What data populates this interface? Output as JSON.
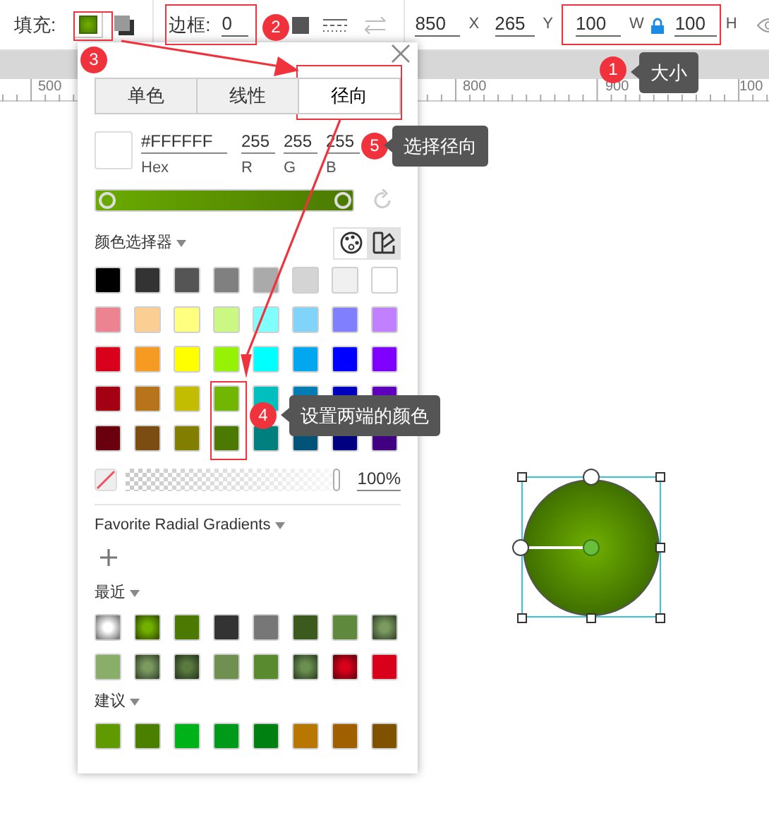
{
  "toolbar": {
    "fill_label": "填充:",
    "border_label": "边框:",
    "border_value": "0",
    "x_value": "850",
    "x_label": "X",
    "y_value": "265",
    "y_label": "Y",
    "w_value": "100",
    "w_label": "W",
    "h_value": "100",
    "h_label": "H",
    "ratio_locked": true
  },
  "ruler": {
    "labels": [
      "500",
      "800",
      "900",
      "100"
    ]
  },
  "color_panel": {
    "tabs": [
      {
        "label": "单色",
        "selected": false
      },
      {
        "label": "线性",
        "selected": false
      },
      {
        "label": "径向",
        "selected": true
      }
    ],
    "hex": "#FFFFFF",
    "hex_label": "Hex",
    "channels": [
      {
        "value": "255",
        "label": "R"
      },
      {
        "value": "255",
        "label": "G"
      },
      {
        "value": "255",
        "label": "B"
      }
    ],
    "gradient_stops": [
      {
        "color": "#6aab00"
      },
      {
        "color": "#4b7902"
      }
    ],
    "picker_label": "颜色选择器",
    "picker_modes": [
      {
        "selected": false
      },
      {
        "selected": true
      }
    ],
    "palette": [
      {
        "color": "#000000"
      },
      {
        "color": "#333333"
      },
      {
        "color": "#555555"
      },
      {
        "color": "#808080"
      },
      {
        "color": "#aaaaaa"
      },
      {
        "color": "#d4d4d4"
      },
      {
        "color": "#f0f0f0"
      },
      {
        "color": "#ffffff"
      },
      {
        "color": "#eb8391"
      },
      {
        "color": "#fbcf93"
      },
      {
        "color": "#ffff80"
      },
      {
        "color": "#cbf783"
      },
      {
        "color": "#80ffff"
      },
      {
        "color": "#80d4fa"
      },
      {
        "color": "#8080ff"
      },
      {
        "color": "#c080ff"
      },
      {
        "color": "#d9001b"
      },
      {
        "color": "#f59a23"
      },
      {
        "color": "#ffff00"
      },
      {
        "color": "#95f204"
      },
      {
        "color": "#00ffff"
      },
      {
        "color": "#02a7f0"
      },
      {
        "color": "#0000ff"
      },
      {
        "color": "#8000ff"
      },
      {
        "color": "#a30014"
      },
      {
        "color": "#b8741a"
      },
      {
        "color": "#c2bd00"
      },
      {
        "color": "#70b603"
      },
      {
        "color": "#00bfbf"
      },
      {
        "color": "#027db4"
      },
      {
        "color": "#0000bf"
      },
      {
        "color": "#6000bf"
      },
      {
        "color": "#6a000d"
      },
      {
        "color": "#7b4d12"
      },
      {
        "color": "#817e00"
      },
      {
        "color": "#4b7902"
      },
      {
        "color": "#007f7f"
      },
      {
        "color": "#015478"
      },
      {
        "color": "#000080"
      },
      {
        "color": "#400080"
      }
    ],
    "opacity_slider": {
      "level": 1
    },
    "opacity": "100%",
    "favorites_label": "Favorite Radial Gradients",
    "recent_label": "最近",
    "recent": [
      {
        "kind": "radial",
        "color": "#ffffff"
      },
      {
        "kind": "radial",
        "color": "#72b000"
      },
      {
        "kind": "solid",
        "color": "#4b7902"
      },
      {
        "kind": "solid",
        "color": "#333333"
      },
      {
        "kind": "solid",
        "color": "#777777"
      },
      {
        "kind": "solid",
        "color": "#3d5a1e"
      },
      {
        "kind": "solid",
        "color": "#5f8a3e"
      },
      {
        "kind": "radial",
        "color": "#7a9a60"
      },
      {
        "kind": "solid",
        "color": "#8aae6a"
      },
      {
        "kind": "radial",
        "color": "#7a9a60"
      },
      {
        "kind": "radial",
        "color": "#5a7a40"
      },
      {
        "kind": "solid",
        "color": "#6f9050"
      },
      {
        "kind": "solid",
        "color": "#5a8a30"
      },
      {
        "kind": "radial",
        "color": "#6a9050"
      },
      {
        "kind": "radial",
        "color": "#d9001b"
      },
      {
        "kind": "solid",
        "color": "#d9001b"
      }
    ],
    "suggested_label": "建议",
    "suggested": [
      {
        "color": "#5f9a00"
      },
      {
        "color": "#4b7f00"
      },
      {
        "color": "#00b21a"
      },
      {
        "color": "#009a1a"
      },
      {
        "color": "#008010"
      },
      {
        "color": "#b87800"
      },
      {
        "color": "#a06000"
      },
      {
        "color": "#7f5200"
      }
    ]
  },
  "annotations": [
    {
      "number": "2"
    },
    {
      "number": "3"
    },
    {
      "number": "1",
      "tooltip": "大小"
    },
    {
      "number": "5",
      "tooltip": "选择径向"
    },
    {
      "number": "4",
      "tooltip": "设置两端的颜色"
    }
  ]
}
